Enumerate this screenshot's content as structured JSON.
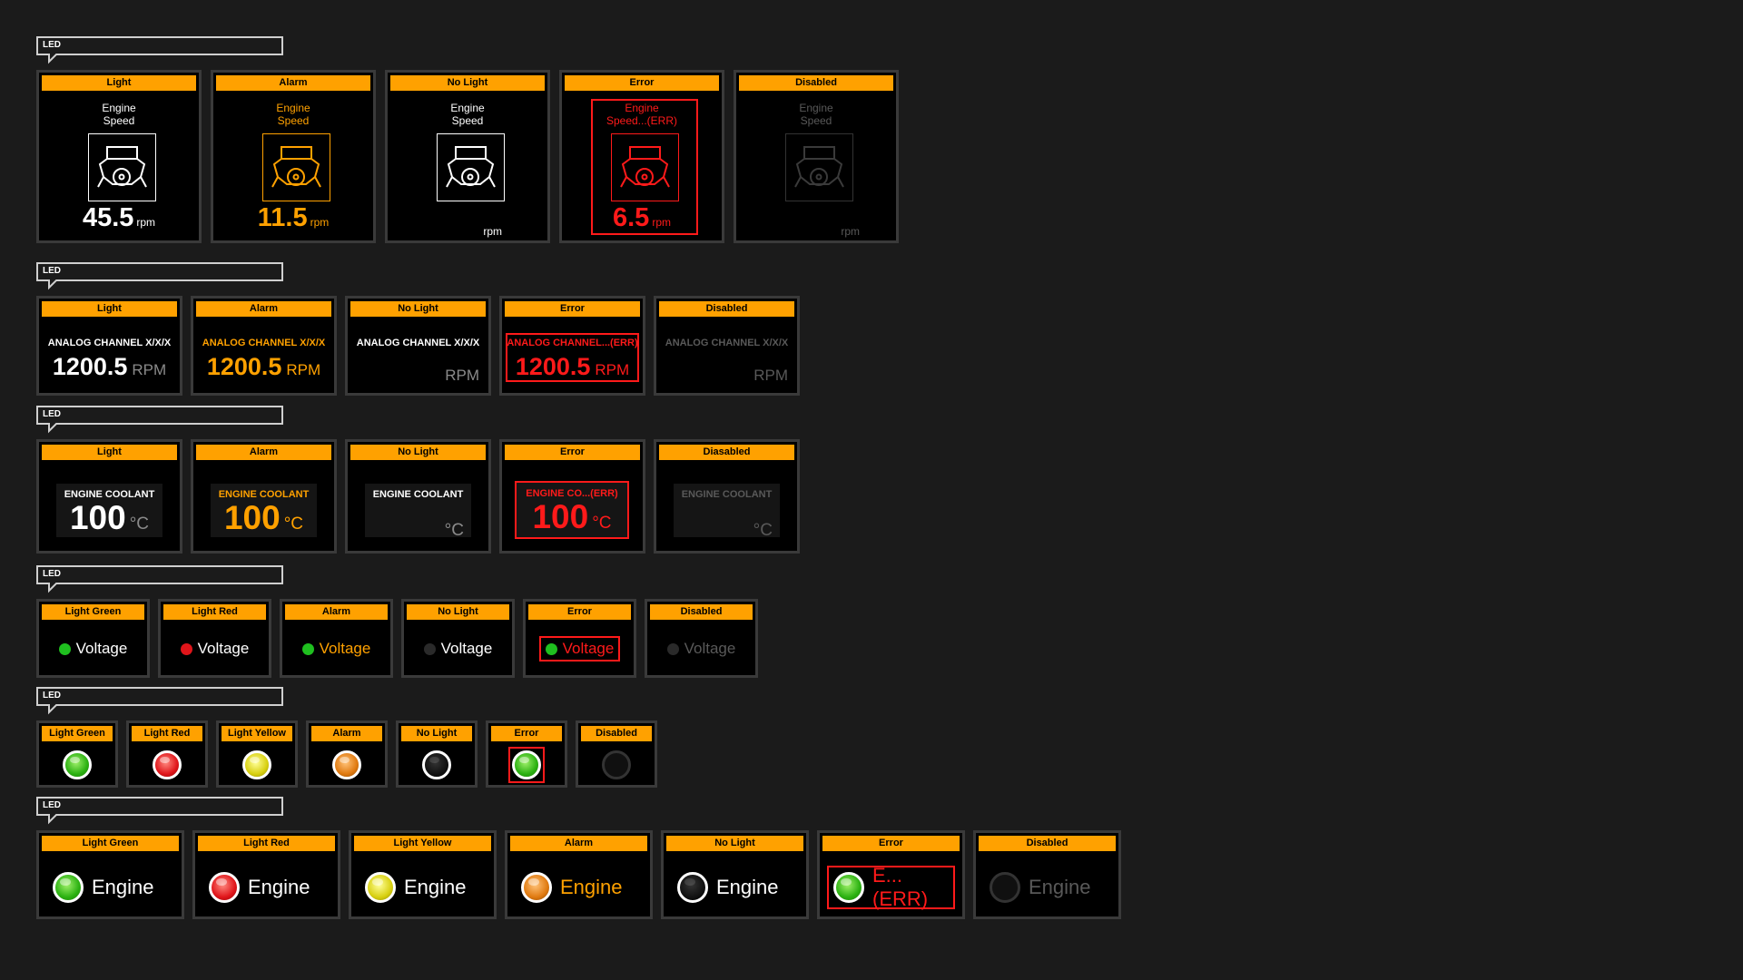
{
  "colors": {
    "background": "#1b1b1b",
    "caption": "#ffa100",
    "alarm": "#ffa100",
    "error": "#ff1a1a",
    "disabled": "#595959"
  },
  "section_label": "LED",
  "row1": {
    "name_line1": "Engine",
    "name_line2": "Speed",
    "error_name_line2": "Speed...(ERR)",
    "unit": "rpm",
    "icon": "engine-icon",
    "cards": [
      {
        "caption": "Light",
        "value": "45.5"
      },
      {
        "caption": "Alarm",
        "value": "11.5"
      },
      {
        "caption": "No Light",
        "value": ""
      },
      {
        "caption": "Error",
        "value": "6.5"
      },
      {
        "caption": "Disabled",
        "value": ""
      }
    ]
  },
  "row2": {
    "name": "ANALOG CHANNEL X/X/X",
    "error_name": "ANALOG CHANNEL...(ERR)",
    "unit": "RPM",
    "cards": [
      {
        "caption": "Light",
        "value": "1200.5"
      },
      {
        "caption": "Alarm",
        "value": "1200.5"
      },
      {
        "caption": "No Light",
        "value": ""
      },
      {
        "caption": "Error",
        "value": "1200.5"
      },
      {
        "caption": "Disabled",
        "value": ""
      }
    ]
  },
  "row3": {
    "name": "ENGINE COOLANT",
    "error_name": "ENGINE CO...(ERR)",
    "unit": "°C",
    "cards": [
      {
        "caption": "Light",
        "value": "100"
      },
      {
        "caption": "Alarm",
        "value": "100"
      },
      {
        "caption": "No Light",
        "value": ""
      },
      {
        "caption": "Error",
        "value": "100"
      },
      {
        "caption": "Diasabled",
        "value": ""
      }
    ]
  },
  "row4": {
    "label": "Voltage",
    "cards": [
      {
        "caption": "Light Green",
        "dot": "#1fbf1f"
      },
      {
        "caption": "Light Red",
        "dot": "#e0151a"
      },
      {
        "caption": "Alarm",
        "dot": "#1fbf1f"
      },
      {
        "caption": "No Light",
        "dot": "#2a2a2a"
      },
      {
        "caption": "Error",
        "dot": "#1fbf1f"
      },
      {
        "caption": "Disabled",
        "dot": "#2a2a2a"
      }
    ]
  },
  "row5": {
    "cards": [
      {
        "caption": "Light Green",
        "led": "green"
      },
      {
        "caption": "Light Red",
        "led": "red"
      },
      {
        "caption": "Light Yellow",
        "led": "yellow"
      },
      {
        "caption": "Alarm",
        "led": "orange"
      },
      {
        "caption": "No Light",
        "led": "off"
      },
      {
        "caption": "Error",
        "led": "green"
      },
      {
        "caption": "Disabled",
        "led": "disabled"
      }
    ]
  },
  "row6": {
    "label": "Engine",
    "error_label": "E...(ERR)",
    "cards": [
      {
        "caption": "Light Green",
        "led": "green"
      },
      {
        "caption": "Light Red",
        "led": "red"
      },
      {
        "caption": "Light Yellow",
        "led": "yellow"
      },
      {
        "caption": "Alarm",
        "led": "orange"
      },
      {
        "caption": "No Light",
        "led": "off"
      },
      {
        "caption": "Error",
        "led": "green"
      },
      {
        "caption": "Disabled",
        "led": "disabled"
      }
    ]
  }
}
